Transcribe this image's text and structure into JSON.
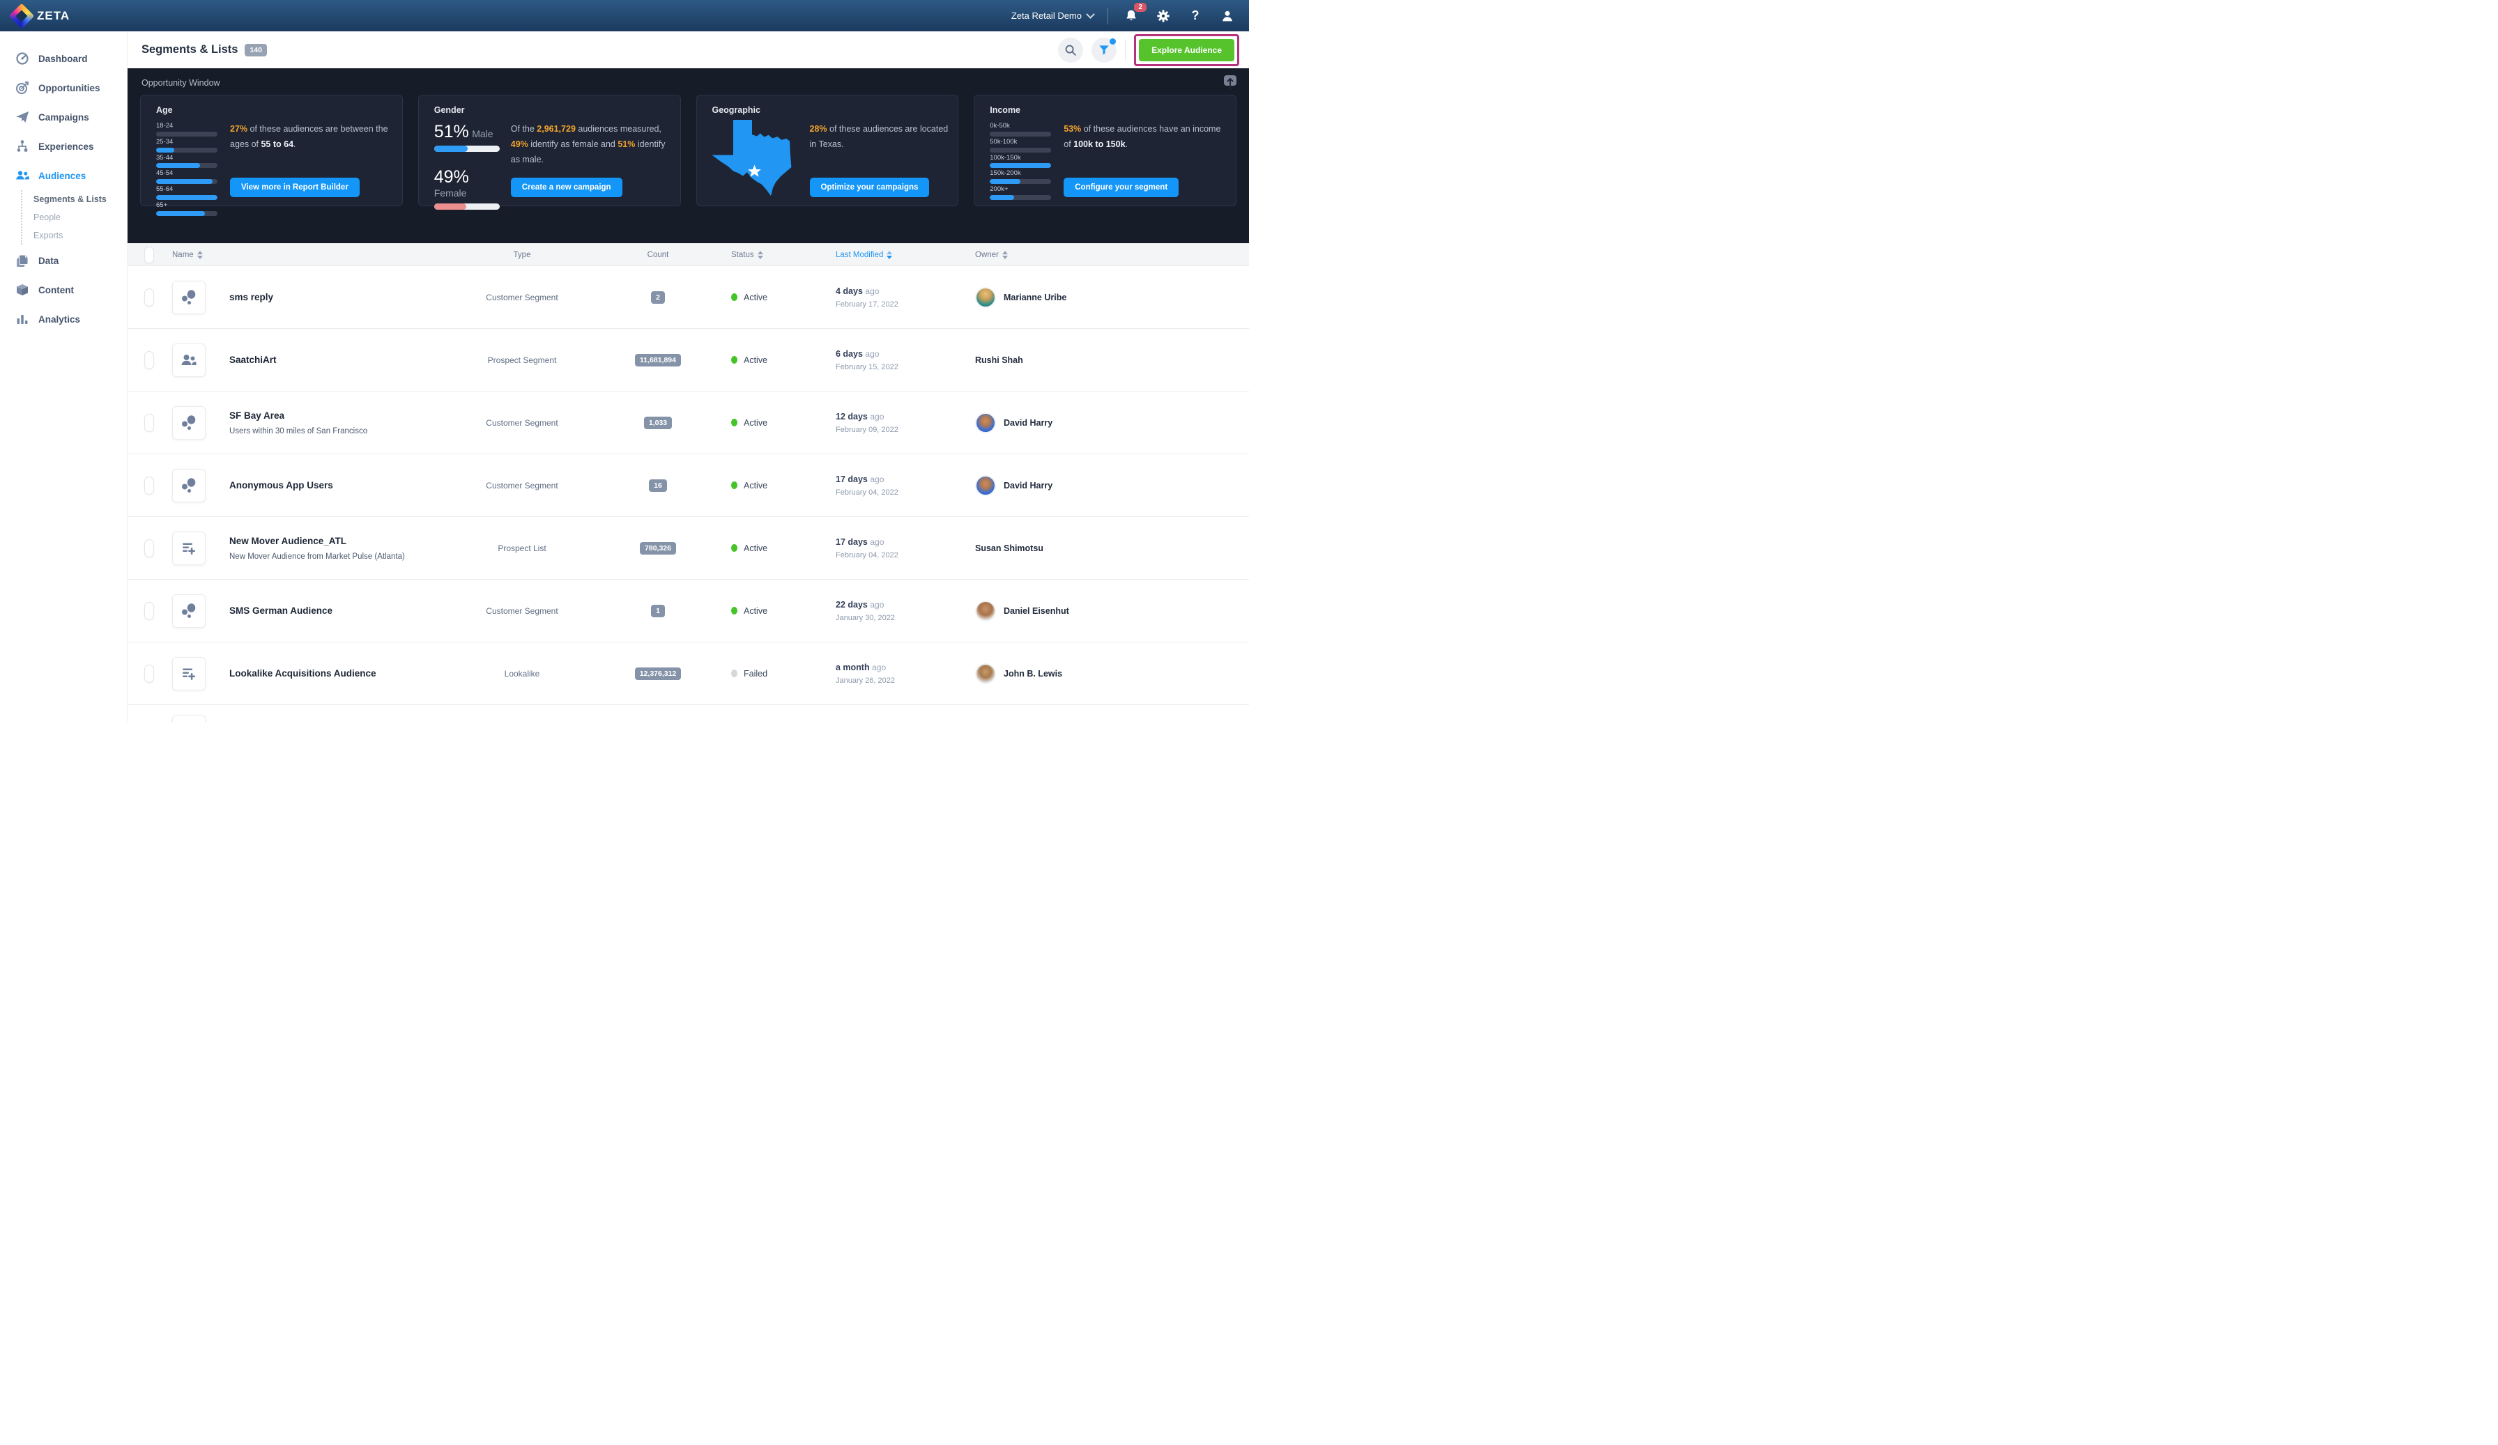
{
  "navbar": {
    "brand": "ZETA",
    "account": "Zeta Retail Demo",
    "notification_count": "2",
    "icons": [
      "bell-icon",
      "gear-icon",
      "help-icon",
      "user-icon"
    ]
  },
  "sidebar": {
    "items": [
      {
        "label": "Dashboard",
        "icon": "dashboard-gauge-icon",
        "active": false
      },
      {
        "label": "Opportunities",
        "icon": "opportunities-target-icon",
        "active": false
      },
      {
        "label": "Campaigns",
        "icon": "campaigns-paper-plane-icon",
        "active": false
      },
      {
        "label": "Experiences",
        "icon": "experiences-flow-icon",
        "active": false
      },
      {
        "label": "Audiences",
        "icon": "audiences-people-icon",
        "active": true
      },
      {
        "label": "Data",
        "icon": "data-stack-icon",
        "active": false
      },
      {
        "label": "Content",
        "icon": "content-box-icon",
        "active": false
      },
      {
        "label": "Analytics",
        "icon": "analytics-bars-icon",
        "active": false
      }
    ],
    "audiences_children": [
      {
        "label": "Segments & Lists",
        "active": true
      },
      {
        "label": "People",
        "active": false
      },
      {
        "label": "Exports",
        "active": false
      }
    ]
  },
  "header": {
    "title": "Segments & Lists",
    "count_badge": "140",
    "explore_button": "Explore Audience",
    "annotation_color": "#b5327c",
    "explore_button_color": "#56c32c"
  },
  "opportunity": {
    "title": "Opportunity Window",
    "accent_blue": "#2196f3",
    "accent_orange": "#f0a22e",
    "cards": {
      "age": {
        "title": "Age",
        "bars": [
          {
            "label": "18-24",
            "width": "0%"
          },
          {
            "label": "25-34",
            "width": "30%"
          },
          {
            "label": "35-44",
            "width": "72%"
          },
          {
            "label": "45-54",
            "width": "92%"
          },
          {
            "label": "55-64",
            "width": "100%"
          },
          {
            "label": "65+",
            "width": "80%"
          }
        ],
        "hl": "27%",
        "text_a": " of these audiences are between the ages of ",
        "strong": "55 to 64",
        "text_b": ".",
        "button": "View more in Report Builder"
      },
      "gender": {
        "title": "Gender",
        "male_pct": "51%",
        "male_label": "Male",
        "male_width": "51%",
        "female_pct": "49%",
        "female_label": "Female",
        "female_width": "49%",
        "t1": "Of the ",
        "h1": "2,961,729",
        "t2": " audiences measured, ",
        "h2": "49%",
        "t3": " identify as female and ",
        "h3": "51%",
        "t4": " identify as male.",
        "button": "Create a new campaign"
      },
      "geographic": {
        "title": "Geographic",
        "map": "texas-map-icon",
        "hl": "28%",
        "text_a": " of these audiences are located in Texas.",
        "button": "Optimize your campaigns"
      },
      "income": {
        "title": "Income",
        "bars": [
          {
            "label": "0k-50k",
            "width": "0%"
          },
          {
            "label": "50k-100k",
            "width": "0%"
          },
          {
            "label": "100k-150k",
            "width": "100%"
          },
          {
            "label": "150k-200k",
            "width": "50%"
          },
          {
            "label": "200k+",
            "width": "40%"
          }
        ],
        "hl": "53%",
        "text_a": " of these audiences have an income of ",
        "strong": "100k to 150k",
        "text_b": ".",
        "button": "Configure your segment"
      }
    }
  },
  "table": {
    "columns": {
      "name": "Name",
      "type": "Type",
      "count": "Count",
      "status": "Status",
      "modified": "Last Modified",
      "owner": "Owner"
    },
    "sorted_column": "Last Modified",
    "status_colors": {
      "active": "#45c428",
      "failed": "#d5d7da"
    },
    "rows": [
      {
        "name": "sms reply",
        "subtitle": "",
        "icon": "segment-dots-icon",
        "type": "Customer Segment",
        "count": "2",
        "status": "Active",
        "status_color": "#45c428",
        "days": "4 days",
        "ago": "ago",
        "date": "February 17, 2022",
        "owner": {
          "name": "Marianne Uribe",
          "avatar_bg": "radial-gradient(circle at 50% 30%, #e8c27a 0%, #caa05a 35%, #2f8e88 70%, #27706c 100%)"
        }
      },
      {
        "name": "SaatchiArt",
        "subtitle": "",
        "icon": "prospect-people-icon",
        "type": "Prospect Segment",
        "count": "11,681,894",
        "status": "Active",
        "status_color": "#45c428",
        "days": "6 days",
        "ago": "ago",
        "date": "February 15, 2022",
        "owner": {
          "name": "Rushi Shah",
          "avatar_bg": ""
        }
      },
      {
        "name": "SF Bay Area",
        "subtitle": "Users within 30 miles of San Francisco",
        "icon": "segment-dots-icon",
        "type": "Customer Segment",
        "count": "1,033",
        "status": "Active",
        "status_color": "#45c428",
        "days": "12 days",
        "ago": "ago",
        "date": "February 09, 2022",
        "owner": {
          "name": "David Harry",
          "avatar_bg": "radial-gradient(circle at 50% 40%, #c98f62 0%, #b57a50 30%, #3b6fd6 65%, #2b4fa8 100%)"
        }
      },
      {
        "name": "Anonymous App Users",
        "subtitle": "",
        "icon": "segment-dots-icon",
        "type": "Customer Segment",
        "count": "16",
        "status": "Active",
        "status_color": "#45c428",
        "days": "17 days",
        "ago": "ago",
        "date": "February 04, 2022",
        "owner": {
          "name": "David Harry",
          "avatar_bg": "radial-gradient(circle at 50% 40%, #c98f62 0%, #b57a50 30%, #3b6fd6 65%, #2b4fa8 100%)"
        }
      },
      {
        "name": "New Mover Audience_ATL",
        "subtitle": "New Mover Audience from Market Pulse (Atlanta)",
        "icon": "list-plus-icon",
        "type": "Prospect List",
        "count": "780,326",
        "status": "Active",
        "status_color": "#45c428",
        "days": "17 days",
        "ago": "ago",
        "date": "February 04, 2022",
        "owner": {
          "name": "Susan Shimotsu",
          "avatar_bg": ""
        }
      },
      {
        "name": "SMS German Audience",
        "subtitle": "",
        "icon": "segment-dots-icon",
        "type": "Customer Segment",
        "count": "1",
        "status": "Active",
        "status_color": "#45c428",
        "days": "22 days",
        "ago": "ago",
        "date": "January 30, 2022",
        "owner": {
          "name": "Daniel Eisenhut",
          "avatar_bg": "radial-gradient(circle at 50% 38%, #c79067 0%, #a9734d 45%, #e4ded6 75%, #d8d2c9 100%)"
        }
      },
      {
        "name": "Lookalike Acquisitions Audience",
        "subtitle": "",
        "icon": "list-plus-icon",
        "type": "Lookalike",
        "count": "12,376,312",
        "status": "Failed",
        "status_color": "#d5d7da",
        "days": "a month",
        "ago": "ago",
        "date": "January 26, 2022",
        "owner": {
          "name": "John B. Lewis",
          "avatar_bg": "radial-gradient(circle at 50% 40%, #c79b6b 0%, #a87a4e 40%, #e0e0e2 75%, #d6d7d9 100%)"
        }
      }
    ]
  }
}
